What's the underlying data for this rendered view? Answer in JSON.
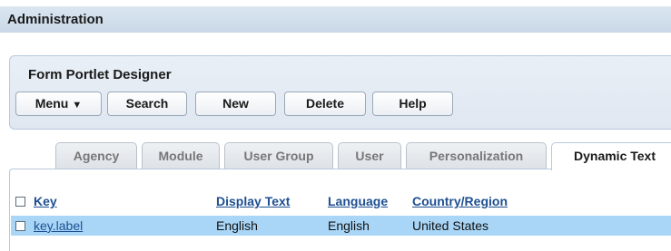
{
  "admin": {
    "title": "Administration"
  },
  "portlet": {
    "title": "Form Portlet Designer",
    "buttons": {
      "menu": "Menu",
      "search": "Search",
      "new": "New",
      "delete": "Delete",
      "help": "Help"
    }
  },
  "tabs": [
    "Agency",
    "Module",
    "User Group",
    "User",
    "Personalization",
    "Dynamic Text"
  ],
  "active_tab": "Dynamic Text",
  "table": {
    "columns": [
      "Key",
      "Display Text",
      "Language",
      "Country/Region"
    ],
    "rows": [
      {
        "key": "key.label",
        "display_text": "English",
        "language": "English",
        "country_region": "United States",
        "selected": true
      }
    ]
  },
  "icons": {
    "menu_caret": "chevron-down-icon"
  },
  "colors": {
    "accent": "#1d4f91",
    "selected_row": "#a9d6f7",
    "header_bar": "#c9d8e8"
  }
}
